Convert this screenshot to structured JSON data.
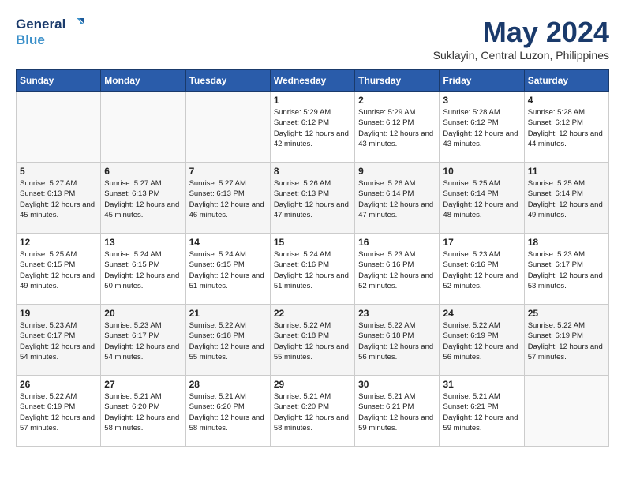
{
  "header": {
    "logo_line1": "General",
    "logo_line2": "Blue",
    "month": "May 2024",
    "location": "Suklayin, Central Luzon, Philippines"
  },
  "weekdays": [
    "Sunday",
    "Monday",
    "Tuesday",
    "Wednesday",
    "Thursday",
    "Friday",
    "Saturday"
  ],
  "weeks": [
    [
      {
        "day": "",
        "sunrise": "",
        "sunset": "",
        "daylight": ""
      },
      {
        "day": "",
        "sunrise": "",
        "sunset": "",
        "daylight": ""
      },
      {
        "day": "",
        "sunrise": "",
        "sunset": "",
        "daylight": ""
      },
      {
        "day": "1",
        "sunrise": "Sunrise: 5:29 AM",
        "sunset": "Sunset: 6:12 PM",
        "daylight": "Daylight: 12 hours and 42 minutes."
      },
      {
        "day": "2",
        "sunrise": "Sunrise: 5:29 AM",
        "sunset": "Sunset: 6:12 PM",
        "daylight": "Daylight: 12 hours and 43 minutes."
      },
      {
        "day": "3",
        "sunrise": "Sunrise: 5:28 AM",
        "sunset": "Sunset: 6:12 PM",
        "daylight": "Daylight: 12 hours and 43 minutes."
      },
      {
        "day": "4",
        "sunrise": "Sunrise: 5:28 AM",
        "sunset": "Sunset: 6:12 PM",
        "daylight": "Daylight: 12 hours and 44 minutes."
      }
    ],
    [
      {
        "day": "5",
        "sunrise": "Sunrise: 5:27 AM",
        "sunset": "Sunset: 6:13 PM",
        "daylight": "Daylight: 12 hours and 45 minutes."
      },
      {
        "day": "6",
        "sunrise": "Sunrise: 5:27 AM",
        "sunset": "Sunset: 6:13 PM",
        "daylight": "Daylight: 12 hours and 45 minutes."
      },
      {
        "day": "7",
        "sunrise": "Sunrise: 5:27 AM",
        "sunset": "Sunset: 6:13 PM",
        "daylight": "Daylight: 12 hours and 46 minutes."
      },
      {
        "day": "8",
        "sunrise": "Sunrise: 5:26 AM",
        "sunset": "Sunset: 6:13 PM",
        "daylight": "Daylight: 12 hours and 47 minutes."
      },
      {
        "day": "9",
        "sunrise": "Sunrise: 5:26 AM",
        "sunset": "Sunset: 6:14 PM",
        "daylight": "Daylight: 12 hours and 47 minutes."
      },
      {
        "day": "10",
        "sunrise": "Sunrise: 5:25 AM",
        "sunset": "Sunset: 6:14 PM",
        "daylight": "Daylight: 12 hours and 48 minutes."
      },
      {
        "day": "11",
        "sunrise": "Sunrise: 5:25 AM",
        "sunset": "Sunset: 6:14 PM",
        "daylight": "Daylight: 12 hours and 49 minutes."
      }
    ],
    [
      {
        "day": "12",
        "sunrise": "Sunrise: 5:25 AM",
        "sunset": "Sunset: 6:15 PM",
        "daylight": "Daylight: 12 hours and 49 minutes."
      },
      {
        "day": "13",
        "sunrise": "Sunrise: 5:24 AM",
        "sunset": "Sunset: 6:15 PM",
        "daylight": "Daylight: 12 hours and 50 minutes."
      },
      {
        "day": "14",
        "sunrise": "Sunrise: 5:24 AM",
        "sunset": "Sunset: 6:15 PM",
        "daylight": "Daylight: 12 hours and 51 minutes."
      },
      {
        "day": "15",
        "sunrise": "Sunrise: 5:24 AM",
        "sunset": "Sunset: 6:16 PM",
        "daylight": "Daylight: 12 hours and 51 minutes."
      },
      {
        "day": "16",
        "sunrise": "Sunrise: 5:23 AM",
        "sunset": "Sunset: 6:16 PM",
        "daylight": "Daylight: 12 hours and 52 minutes."
      },
      {
        "day": "17",
        "sunrise": "Sunrise: 5:23 AM",
        "sunset": "Sunset: 6:16 PM",
        "daylight": "Daylight: 12 hours and 52 minutes."
      },
      {
        "day": "18",
        "sunrise": "Sunrise: 5:23 AM",
        "sunset": "Sunset: 6:17 PM",
        "daylight": "Daylight: 12 hours and 53 minutes."
      }
    ],
    [
      {
        "day": "19",
        "sunrise": "Sunrise: 5:23 AM",
        "sunset": "Sunset: 6:17 PM",
        "daylight": "Daylight: 12 hours and 54 minutes."
      },
      {
        "day": "20",
        "sunrise": "Sunrise: 5:23 AM",
        "sunset": "Sunset: 6:17 PM",
        "daylight": "Daylight: 12 hours and 54 minutes."
      },
      {
        "day": "21",
        "sunrise": "Sunrise: 5:22 AM",
        "sunset": "Sunset: 6:18 PM",
        "daylight": "Daylight: 12 hours and 55 minutes."
      },
      {
        "day": "22",
        "sunrise": "Sunrise: 5:22 AM",
        "sunset": "Sunset: 6:18 PM",
        "daylight": "Daylight: 12 hours and 55 minutes."
      },
      {
        "day": "23",
        "sunrise": "Sunrise: 5:22 AM",
        "sunset": "Sunset: 6:18 PM",
        "daylight": "Daylight: 12 hours and 56 minutes."
      },
      {
        "day": "24",
        "sunrise": "Sunrise: 5:22 AM",
        "sunset": "Sunset: 6:19 PM",
        "daylight": "Daylight: 12 hours and 56 minutes."
      },
      {
        "day": "25",
        "sunrise": "Sunrise: 5:22 AM",
        "sunset": "Sunset: 6:19 PM",
        "daylight": "Daylight: 12 hours and 57 minutes."
      }
    ],
    [
      {
        "day": "26",
        "sunrise": "Sunrise: 5:22 AM",
        "sunset": "Sunset: 6:19 PM",
        "daylight": "Daylight: 12 hours and 57 minutes."
      },
      {
        "day": "27",
        "sunrise": "Sunrise: 5:21 AM",
        "sunset": "Sunset: 6:20 PM",
        "daylight": "Daylight: 12 hours and 58 minutes."
      },
      {
        "day": "28",
        "sunrise": "Sunrise: 5:21 AM",
        "sunset": "Sunset: 6:20 PM",
        "daylight": "Daylight: 12 hours and 58 minutes."
      },
      {
        "day": "29",
        "sunrise": "Sunrise: 5:21 AM",
        "sunset": "Sunset: 6:20 PM",
        "daylight": "Daylight: 12 hours and 58 minutes."
      },
      {
        "day": "30",
        "sunrise": "Sunrise: 5:21 AM",
        "sunset": "Sunset: 6:21 PM",
        "daylight": "Daylight: 12 hours and 59 minutes."
      },
      {
        "day": "31",
        "sunrise": "Sunrise: 5:21 AM",
        "sunset": "Sunset: 6:21 PM",
        "daylight": "Daylight: 12 hours and 59 minutes."
      },
      {
        "day": "",
        "sunrise": "",
        "sunset": "",
        "daylight": ""
      }
    ]
  ]
}
